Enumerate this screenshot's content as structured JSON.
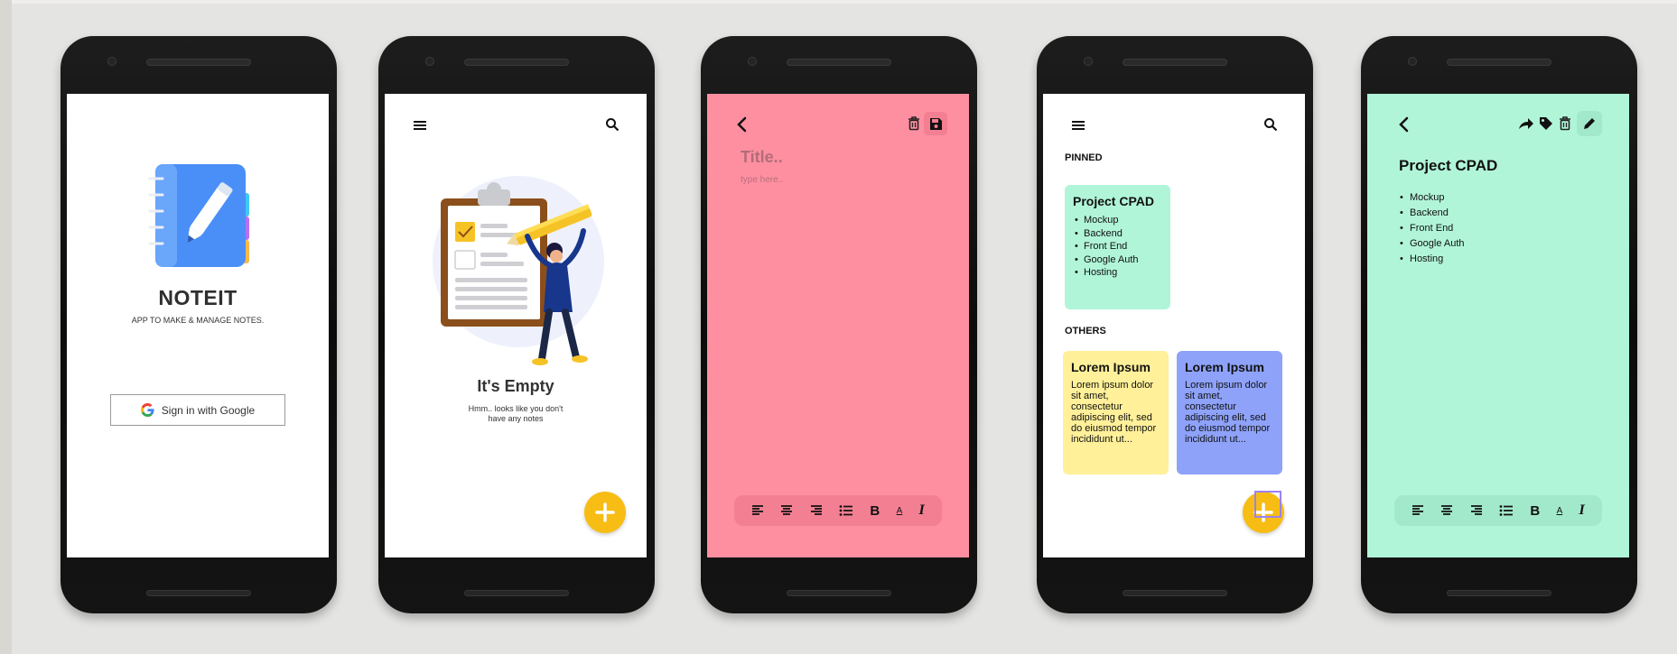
{
  "screen1": {
    "title": "NOTEIT",
    "subtitle": "APP TO MAKE & MANAGE NOTES.",
    "google_button_label": "Sign in with Google"
  },
  "screen2": {
    "empty_title": "It's Empty",
    "empty_subtitle": "Hmm.. looks like you don't have any notes"
  },
  "screen3": {
    "title_placeholder": "Title..",
    "body_placeholder": "type here..",
    "background": "#fe8fa1",
    "toolbar_background": "#f37f92"
  },
  "screen4": {
    "pinned_label": "PINNED",
    "others_label": "OTHERS",
    "pinned_card": {
      "title": "Project CPAD",
      "items": [
        "Mockup",
        "Backend",
        "Front End",
        "Google Auth",
        "Hosting"
      ],
      "color": "#b1f5d9"
    },
    "other_cards": [
      {
        "title": "Lorem Ipsum",
        "body": "Lorem ipsum dolor sit amet, consectetur adipiscing elit, sed do eiusmod tempor incididunt ut...",
        "color": "#fff099"
      },
      {
        "title": "Lorem Ipsum",
        "body": "Lorem ipsum dolor sit amet, consectetur adipiscing elit, sed do eiusmod tempor incididunt ut...",
        "color": "#8ea2f9"
      }
    ]
  },
  "screen5": {
    "title": "Project CPAD",
    "items": [
      "Mockup",
      "Backend",
      "Front End",
      "Google Auth",
      "Hosting"
    ],
    "background": "#b1f5d9"
  },
  "colors": {
    "accent": "#f7bd14"
  },
  "toolbar_labels": {
    "bold": "B",
    "text_color": "A",
    "italic": "I"
  }
}
